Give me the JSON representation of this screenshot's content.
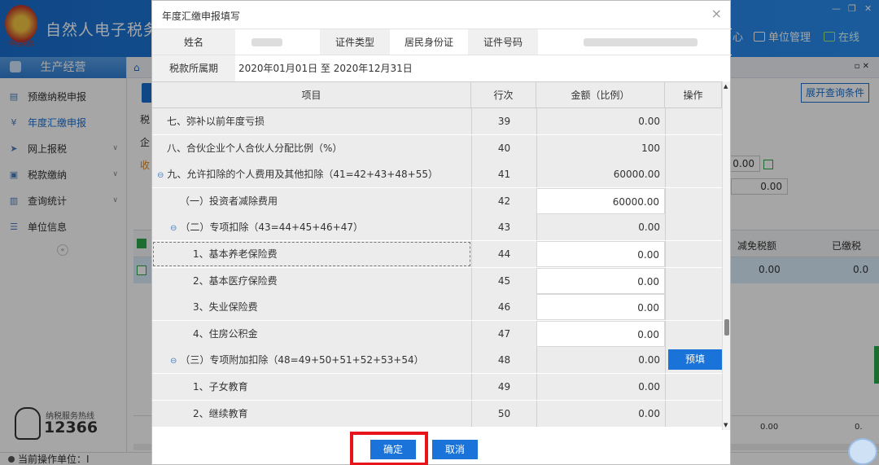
{
  "app": {
    "title": "自然人电子税务局",
    "emblem_caption": "中国税务",
    "window_controls": [
      "—",
      "❐",
      "✕"
    ],
    "top_links": [
      {
        "label": "单位管理",
        "icon": "building-icon"
      },
      {
        "label": "在线",
        "icon": "monitor-icon"
      }
    ],
    "partial_link": "心"
  },
  "sidebar": {
    "header": "生产经营",
    "items": [
      {
        "label": "预缴纳税申报",
        "icon": "doc-icon",
        "active": false,
        "expandable": false
      },
      {
        "label": "年度汇缴申报",
        "icon": "yen-icon",
        "active": true,
        "expandable": false
      },
      {
        "label": "网上报税",
        "icon": "send-icon",
        "active": false,
        "expandable": true
      },
      {
        "label": "税款缴纳",
        "icon": "wallet-icon",
        "active": false,
        "expandable": true
      },
      {
        "label": "查询统计",
        "icon": "search-doc-icon",
        "active": false,
        "expandable": true
      },
      {
        "label": "单位信息",
        "icon": "list-icon",
        "active": false,
        "expandable": false
      }
    ],
    "hotline_label": "纳税服务热线",
    "hotline_number": "12366"
  },
  "statusbar": {
    "label": "当前操作单位：",
    "value": "Ⅰ"
  },
  "background": {
    "expand_query": "展开查询条件",
    "left_chars": [
      "税",
      "企",
      "收"
    ],
    "value_top": "0.00",
    "value_mid": "0.00",
    "table_headers": [
      "减免税额",
      "已缴税"
    ],
    "table_row": [
      "0.00",
      "0.0"
    ],
    "footer": [
      "0.00",
      "0."
    ]
  },
  "modal": {
    "title": "年度汇缴申报填写",
    "close": "×",
    "info": {
      "name_label": "姓名",
      "id_type_label": "证件类型",
      "id_type_value": "居民身份证",
      "id_no_label": "证件号码",
      "period_label": "税款所属期",
      "period_value": "2020年01月01日 至 2020年12月31日"
    },
    "columns": [
      "项目",
      "行次",
      "金额（比例）",
      "操作"
    ],
    "rows": [
      {
        "item": "七、弥补以前年度亏损",
        "line": "39",
        "amount": "0.00",
        "indent": 0,
        "expand": "",
        "editable": false,
        "action": "",
        "selected": false
      },
      {
        "item": "八、合伙企业个人合伙人分配比例（%）",
        "line": "40",
        "amount": "100",
        "indent": 0,
        "expand": "",
        "editable": false,
        "action": "",
        "selected": false
      },
      {
        "item": "九、允许扣除的个人费用及其他扣除（41=42+43+48+55）",
        "line": "41",
        "amount": "60000.00",
        "indent": 0,
        "expand": "⊖",
        "editable": false,
        "action": "",
        "selected": false
      },
      {
        "item": "（一）投资者减除费用",
        "line": "42",
        "amount": "60000.00",
        "indent": 1,
        "expand": "",
        "editable": true,
        "action": "",
        "selected": false
      },
      {
        "item": "（二）专项扣除（43=44+45+46+47）",
        "line": "43",
        "amount": "0.00",
        "indent": 1,
        "expand": "⊖",
        "editable": false,
        "action": "",
        "selected": false
      },
      {
        "item": "1、基本养老保险费",
        "line": "44",
        "amount": "0.00",
        "indent": 2,
        "expand": "",
        "editable": true,
        "action": "",
        "selected": true
      },
      {
        "item": "2、基本医疗保险费",
        "line": "45",
        "amount": "0.00",
        "indent": 2,
        "expand": "",
        "editable": true,
        "action": "",
        "selected": false
      },
      {
        "item": "3、失业保险费",
        "line": "46",
        "amount": "0.00",
        "indent": 2,
        "expand": "",
        "editable": true,
        "action": "",
        "selected": false
      },
      {
        "item": "4、住房公积金",
        "line": "47",
        "amount": "0.00",
        "indent": 2,
        "expand": "",
        "editable": true,
        "action": "",
        "selected": false
      },
      {
        "item": "（三）专项附加扣除（48=49+50+51+52+53+54）",
        "line": "48",
        "amount": "0.00",
        "indent": 1,
        "expand": "⊖",
        "editable": false,
        "action": "预填",
        "selected": false
      },
      {
        "item": "1、子女教育",
        "line": "49",
        "amount": "0.00",
        "indent": 2,
        "expand": "",
        "editable": false,
        "action": "",
        "selected": false
      },
      {
        "item": "2、继续教育",
        "line": "50",
        "amount": "0.00",
        "indent": 2,
        "expand": "",
        "editable": false,
        "action": "",
        "selected": false
      }
    ],
    "confirm": "确定",
    "cancel": "取消"
  },
  "colors": {
    "brand_blue": "#1a6fd0",
    "button_blue": "#1a73d9",
    "highlight_red": "#e8141c"
  }
}
